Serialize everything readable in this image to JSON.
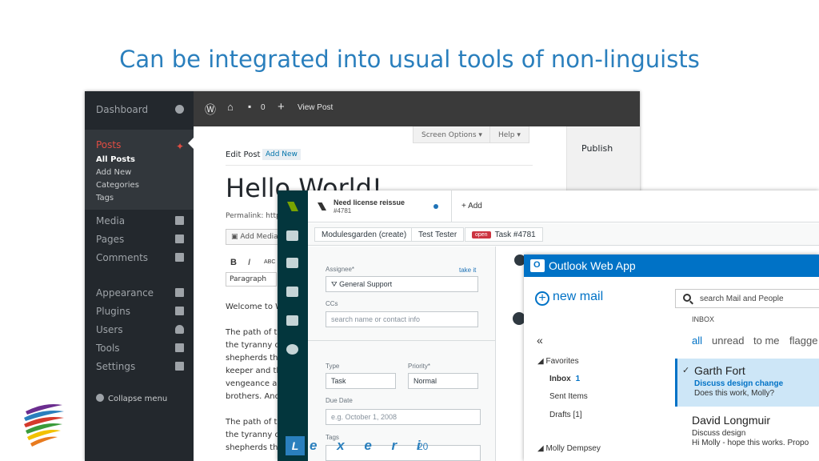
{
  "slide": {
    "title": "Can be integrated into usual tools of non-linguists",
    "page_number": "20",
    "brand_mark": "L",
    "brand_word": "e x e r i"
  },
  "wordpress": {
    "sidebar": {
      "dashboard": "Dashboard",
      "posts": "Posts",
      "all_posts": "All Posts",
      "add_new": "Add New",
      "categories": "Categories",
      "tags": "Tags",
      "media": "Media",
      "pages": "Pages",
      "comments": "Comments",
      "appearance": "Appearance",
      "plugins": "Plugins",
      "users": "Users",
      "tools": "Tools",
      "settings": "Settings",
      "collapse": "Collapse menu"
    },
    "topbar": {
      "comments_count": "0",
      "view_post": "View Post"
    },
    "screen_options": "Screen Options",
    "help": "Help",
    "edit_post": "Edit Post",
    "add_new_btn": "Add New",
    "post_title": "Hello World!",
    "permalink": "Permalink: http",
    "add_media": "Add Media",
    "format": "Paragraph",
    "publish": "Publish",
    "body_lines": [
      "Welcome to W",
      "The path of th",
      "the tyranny of",
      "shepherds the",
      "keeper and th",
      "vengeance and",
      "brothers. And",
      "The path of th",
      "the tyranny o",
      "shepherds the"
    ]
  },
  "helpdesk": {
    "ticket_title": "Need license reissue",
    "ticket_id": "#4781",
    "add": "Add",
    "crumbs": [
      "Modulesgarden (create)",
      "Test Tester"
    ],
    "status_badge": "open",
    "crumb_ticket": "Task #4781",
    "assignee_label": "Assignee*",
    "take_it": "take it",
    "assignee_value": "General Support",
    "ccs_label": "CCs",
    "ccs_placeholder": "search name or contact info",
    "type_label": "Type",
    "type_value": "Task",
    "priority_label": "Priority*",
    "priority_value": "Normal",
    "due_label": "Due Date",
    "due_placeholder": "e.g. October 1, 2008",
    "tags_label": "Tags"
  },
  "outlook": {
    "app_title": "Outlook Web App",
    "new_mail": "new mail",
    "search_placeholder": "search Mail and People",
    "inbox_label": "INBOX",
    "filters": [
      "all",
      "unread",
      "to me",
      "flagge"
    ],
    "favorites": "Favorites",
    "folders": {
      "inbox": "Inbox",
      "inbox_count": "1",
      "sent": "Sent Items",
      "drafts": "Drafts [1]",
      "account": "Molly Dempsey"
    },
    "messages": [
      {
        "from": "Garth Fort",
        "subject": "Discuss design change",
        "preview": "Does this work, Molly?"
      },
      {
        "from": "David Longmuir",
        "subject": "Discuss design",
        "preview": "Hi Molly - hope this works. Propo"
      }
    ]
  }
}
